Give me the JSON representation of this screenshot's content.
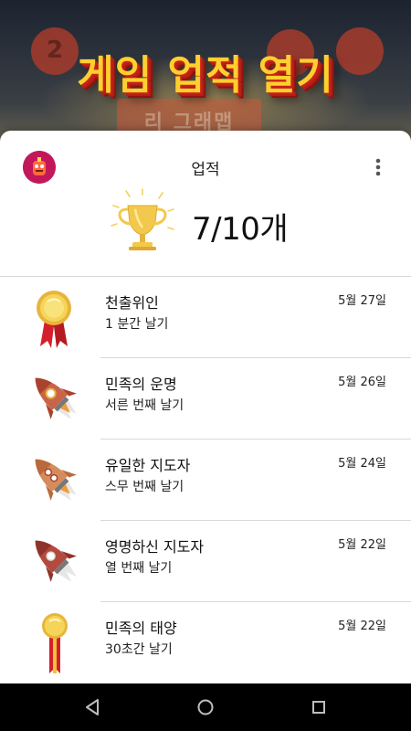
{
  "banner": {
    "title": "게임 업적 열기",
    "badge_left": "2",
    "strip_text": "리 그래맵"
  },
  "header": {
    "title": "업적",
    "achievement_count": "7/10개"
  },
  "achievements": [
    {
      "title": "천출위인",
      "description": "1 분간 날기",
      "date": "5월 27일",
      "icon": "gold-medal-icon"
    },
    {
      "title": "민족의 운명",
      "description": "서른 번째 날기",
      "date": "5월 26일",
      "icon": "rocket-icon"
    },
    {
      "title": "유일한 지도자",
      "description": "스무 번째 날기",
      "date": "5월 24일",
      "icon": "rocket-icon"
    },
    {
      "title": "영명하신 지도자",
      "description": "열 번째 날기",
      "date": "5월 22일",
      "icon": "rocket-icon"
    },
    {
      "title": "민족의 태양",
      "description": "30초간 날기",
      "date": "5월 22일",
      "icon": "gold-medal-icon"
    }
  ],
  "colors": {
    "banner_text": "#ffcf2e",
    "banner_shadow": "#c8231a",
    "medal_gold": "#f2c23a",
    "ribbon_red": "#d3202a",
    "rocket_body": "#c9644a"
  },
  "navigation": {
    "back": "back-icon",
    "home": "home-icon",
    "recents": "recents-icon"
  }
}
